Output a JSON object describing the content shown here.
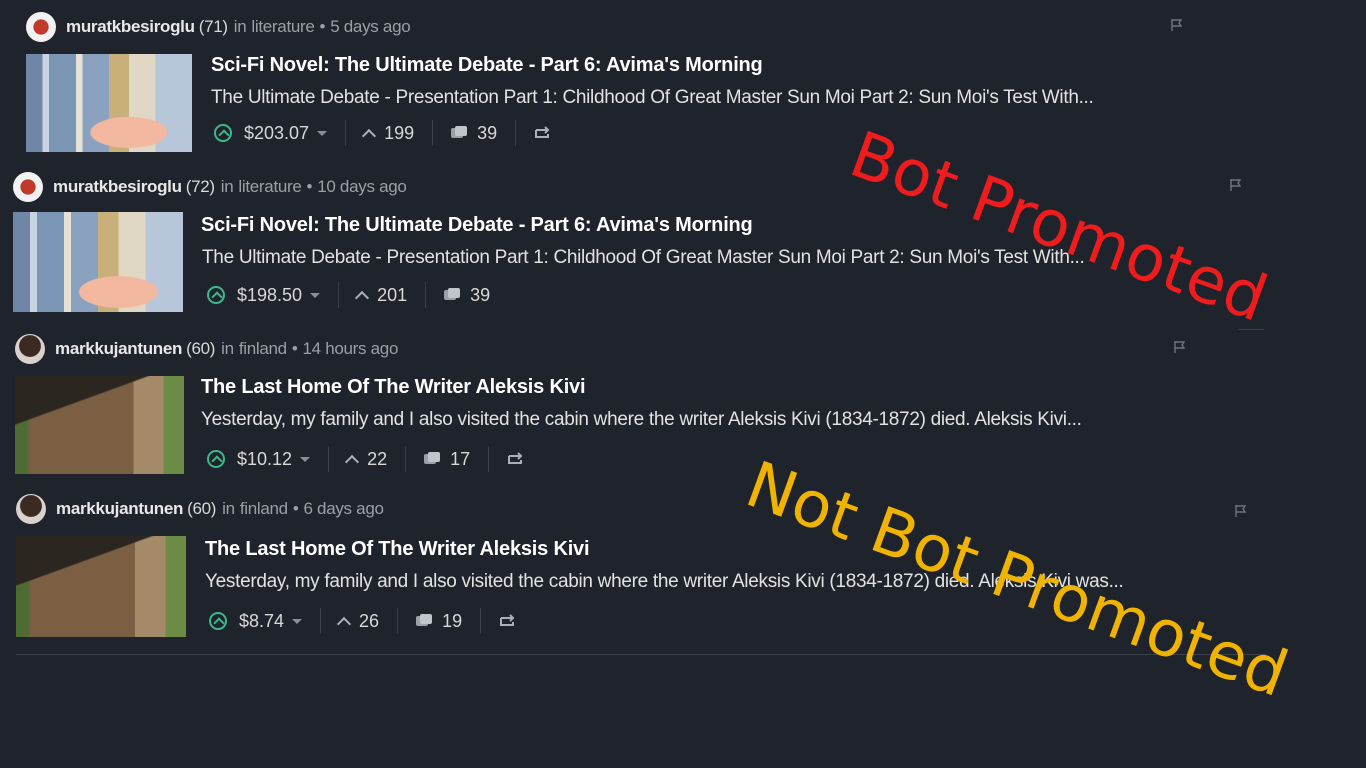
{
  "posts": [
    {
      "author": "muratkbesiroglu",
      "reputation": "(71)",
      "in_text": "in",
      "community": "literature",
      "bullet": "•",
      "time": "5 days ago",
      "title": "Sci-Fi Novel: The Ultimate Debate - Part 6: Avima's Morning",
      "excerpt": "The Ultimate Debate - Presentation Part 1: Childhood Of Great Master Sun Moi Part 2: Sun Moi's Test With...",
      "payout": "$203.07",
      "votes": "199",
      "comments": "39"
    },
    {
      "author": "muratkbesiroglu",
      "reputation": "(72)",
      "in_text": "in",
      "community": "literature",
      "bullet": "•",
      "time": "10 days ago",
      "title": "Sci-Fi Novel: The Ultimate Debate - Part 6: Avima's Morning",
      "excerpt": "The Ultimate Debate - Presentation Part 1: Childhood Of Great Master Sun Moi Part 2: Sun Moi's Test With...",
      "payout": "$198.50",
      "votes": "201",
      "comments": "39"
    },
    {
      "author": "markkujantunen",
      "reputation": "(60)",
      "in_text": "in",
      "community": "finland",
      "bullet": "•",
      "time": "14 hours ago",
      "title": "The Last Home Of The Writer Aleksis Kivi",
      "excerpt": "Yesterday, my family and I also visited the cabin where the writer Aleksis Kivi (1834-1872) died. Aleksis Kivi...",
      "payout": "$10.12",
      "votes": "22",
      "comments": "17"
    },
    {
      "author": "markkujantunen",
      "reputation": "(60)",
      "in_text": "in",
      "community": "finland",
      "bullet": "•",
      "time": "6 days ago",
      "title": "The Last Home Of The Writer Aleksis Kivi",
      "excerpt": "Yesterday, my family and I also visited the cabin where the writer Aleksis Kivi (1834-1872) died. Aleksis Kivi was...",
      "payout": "$8.74",
      "votes": "26",
      "comments": "19"
    }
  ],
  "overlays": {
    "bot": "Bot Promoted",
    "not_bot": "Not Bot Promoted"
  },
  "colors": {
    "background": "#1f232b",
    "upvote_accent": "#3db88b",
    "bot_label": "#ee1c1c",
    "not_bot_label": "#f0b400"
  },
  "icons": [
    "avatar",
    "flag-icon",
    "upvote-icon",
    "caret-down-icon",
    "votes-icon",
    "comments-icon",
    "reblog-icon"
  ]
}
